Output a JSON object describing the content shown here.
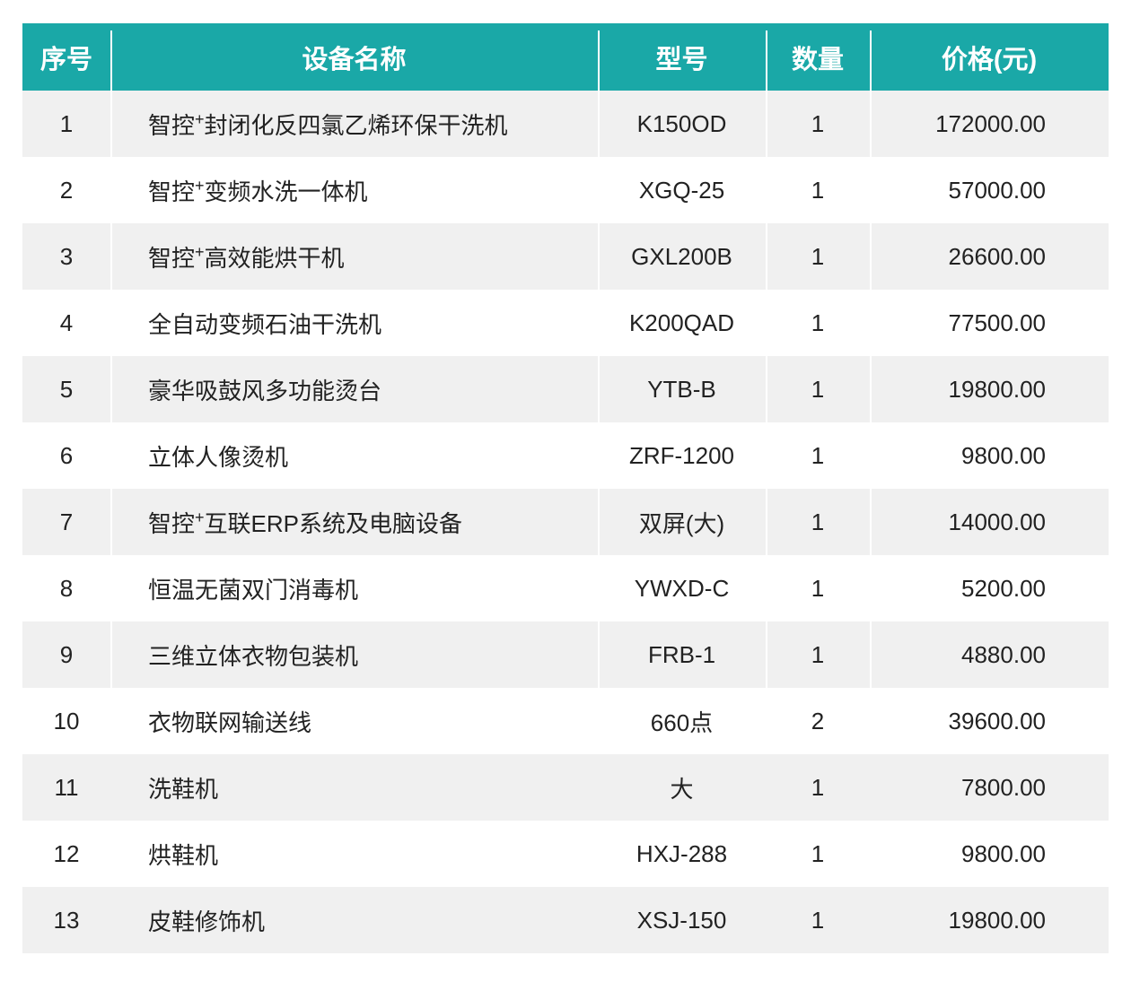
{
  "table": {
    "headers": {
      "index": "序号",
      "name": "设备名称",
      "model": "型号",
      "quantity": "数量",
      "price": "价格(元)"
    },
    "rows": [
      {
        "index": "1",
        "name_prefix": "智控",
        "name_sup": "+",
        "name": "封闭化反四氯乙烯环保干洗机",
        "model": "K150OD",
        "quantity": "1",
        "price": "172000.00"
      },
      {
        "index": "2",
        "name_prefix": "智控",
        "name_sup": "+",
        "name": "变频水洗一体机",
        "model": "XGQ-25",
        "quantity": "1",
        "price": "57000.00"
      },
      {
        "index": "3",
        "name_prefix": "智控",
        "name_sup": "+",
        "name": "高效能烘干机",
        "model": "GXL200B",
        "quantity": "1",
        "price": "26600.00"
      },
      {
        "index": "4",
        "name_prefix": "",
        "name_sup": "",
        "name": "全自动变频石油干洗机",
        "model": "K200QAD",
        "quantity": "1",
        "price": "77500.00"
      },
      {
        "index": "5",
        "name_prefix": "",
        "name_sup": "",
        "name": "豪华吸鼓风多功能烫台",
        "model": "YTB-B",
        "quantity": "1",
        "price": "19800.00"
      },
      {
        "index": "6",
        "name_prefix": "",
        "name_sup": "",
        "name": "立体人像烫机",
        "model": "ZRF-1200",
        "quantity": "1",
        "price": "9800.00"
      },
      {
        "index": "7",
        "name_prefix": "智控",
        "name_sup": "+",
        "name": "互联ERP系统及电脑设备",
        "model": "双屏(大)",
        "quantity": "1",
        "price": "14000.00"
      },
      {
        "index": "8",
        "name_prefix": "",
        "name_sup": "",
        "name": "恒温无菌双门消毒机",
        "model": "YWXD-C",
        "quantity": "1",
        "price": "5200.00"
      },
      {
        "index": "9",
        "name_prefix": "",
        "name_sup": "",
        "name": "三维立体衣物包装机",
        "model": "FRB-1",
        "quantity": "1",
        "price": "4880.00"
      },
      {
        "index": "10",
        "name_prefix": "",
        "name_sup": "",
        "name": "衣物联网输送线",
        "model": "660点",
        "quantity": "2",
        "price": "39600.00"
      },
      {
        "index": "11",
        "name_prefix": "",
        "name_sup": "",
        "name": "洗鞋机",
        "model": "大",
        "quantity": "1",
        "price": "7800.00"
      },
      {
        "index": "12",
        "name_prefix": "",
        "name_sup": "",
        "name": "烘鞋机",
        "model": "HXJ-288",
        "quantity": "1",
        "price": "9800.00"
      },
      {
        "index": "13",
        "name_prefix": "",
        "name_sup": "",
        "name": "皮鞋修饰机",
        "model": "XSJ-150",
        "quantity": "1",
        "price": "19800.00"
      }
    ]
  },
  "colors": {
    "header_bg": "#1aa8a7",
    "header_text": "#ffffff",
    "row_alt_bg": "#f0f0f0",
    "row_bg": "#ffffff",
    "text": "#222222"
  }
}
